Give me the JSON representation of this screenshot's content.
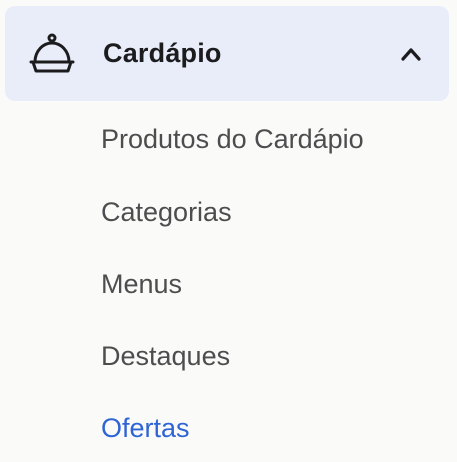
{
  "section": {
    "title": "Cardápio",
    "icon": "cloche-icon",
    "expanded_icon": "chevron-up-icon"
  },
  "items": [
    {
      "label": "Produtos do Cardápio",
      "active": false
    },
    {
      "label": "Categorias",
      "active": false
    },
    {
      "label": "Menus",
      "active": false
    },
    {
      "label": "Destaques",
      "active": false
    },
    {
      "label": "Ofertas",
      "active": true
    }
  ],
  "colors": {
    "header_bg": "#e8edf9",
    "active": "#2f64d4",
    "text": "#4d4d4f",
    "title": "#1c1c1e"
  }
}
